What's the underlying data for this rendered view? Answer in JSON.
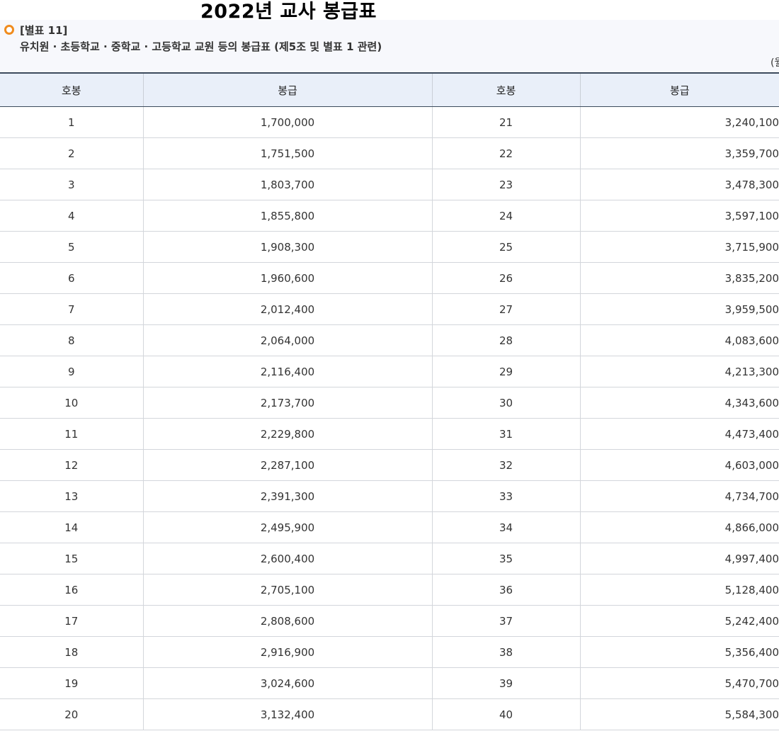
{
  "page_title": "2022년 교사 봉급표",
  "table_label": "[별표 11]",
  "table_caption": "유치원 · 초등학교 · 중학교 · 고등학교 교원 등의 봉급표 (제5조 및 별표 1 관련)",
  "unit_note": "(월",
  "columns": [
    "호봉",
    "봉급",
    "호봉",
    "봉급"
  ],
  "rows": [
    {
      "step_a": "1",
      "pay_a": "1,700,000",
      "step_b": "21",
      "pay_b": "3,240,100"
    },
    {
      "step_a": "2",
      "pay_a": "1,751,500",
      "step_b": "22",
      "pay_b": "3,359,700"
    },
    {
      "step_a": "3",
      "pay_a": "1,803,700",
      "step_b": "23",
      "pay_b": "3,478,300"
    },
    {
      "step_a": "4",
      "pay_a": "1,855,800",
      "step_b": "24",
      "pay_b": "3,597,100"
    },
    {
      "step_a": "5",
      "pay_a": "1,908,300",
      "step_b": "25",
      "pay_b": "3,715,900"
    },
    {
      "step_a": "6",
      "pay_a": "1,960,600",
      "step_b": "26",
      "pay_b": "3,835,200"
    },
    {
      "step_a": "7",
      "pay_a": "2,012,400",
      "step_b": "27",
      "pay_b": "3,959,500"
    },
    {
      "step_a": "8",
      "pay_a": "2,064,000",
      "step_b": "28",
      "pay_b": "4,083,600"
    },
    {
      "step_a": "9",
      "pay_a": "2,116,400",
      "step_b": "29",
      "pay_b": "4,213,300"
    },
    {
      "step_a": "10",
      "pay_a": "2,173,700",
      "step_b": "30",
      "pay_b": "4,343,600"
    },
    {
      "step_a": "11",
      "pay_a": "2,229,800",
      "step_b": "31",
      "pay_b": "4,473,400"
    },
    {
      "step_a": "12",
      "pay_a": "2,287,100",
      "step_b": "32",
      "pay_b": "4,603,000"
    },
    {
      "step_a": "13",
      "pay_a": "2,391,300",
      "step_b": "33",
      "pay_b": "4,734,700"
    },
    {
      "step_a": "14",
      "pay_a": "2,495,900",
      "step_b": "34",
      "pay_b": "4,866,000"
    },
    {
      "step_a": "15",
      "pay_a": "2,600,400",
      "step_b": "35",
      "pay_b": "4,997,400"
    },
    {
      "step_a": "16",
      "pay_a": "2,705,100",
      "step_b": "36",
      "pay_b": "5,128,400"
    },
    {
      "step_a": "17",
      "pay_a": "2,808,600",
      "step_b": "37",
      "pay_b": "5,242,400"
    },
    {
      "step_a": "18",
      "pay_a": "2,916,900",
      "step_b": "38",
      "pay_b": "5,356,400"
    },
    {
      "step_a": "19",
      "pay_a": "3,024,600",
      "step_b": "39",
      "pay_b": "5,470,700"
    },
    {
      "step_a": "20",
      "pay_a": "3,132,400",
      "step_b": "40",
      "pay_b": "5,584,300"
    }
  ],
  "colors": {
    "accent_icon": "#f08c1e",
    "header_bg": "#e9eff9",
    "header_border": "#3c4a5c",
    "info_box_bg": "#f7f8fc"
  },
  "icons": {
    "bullet": "circle-bullet-icon"
  }
}
